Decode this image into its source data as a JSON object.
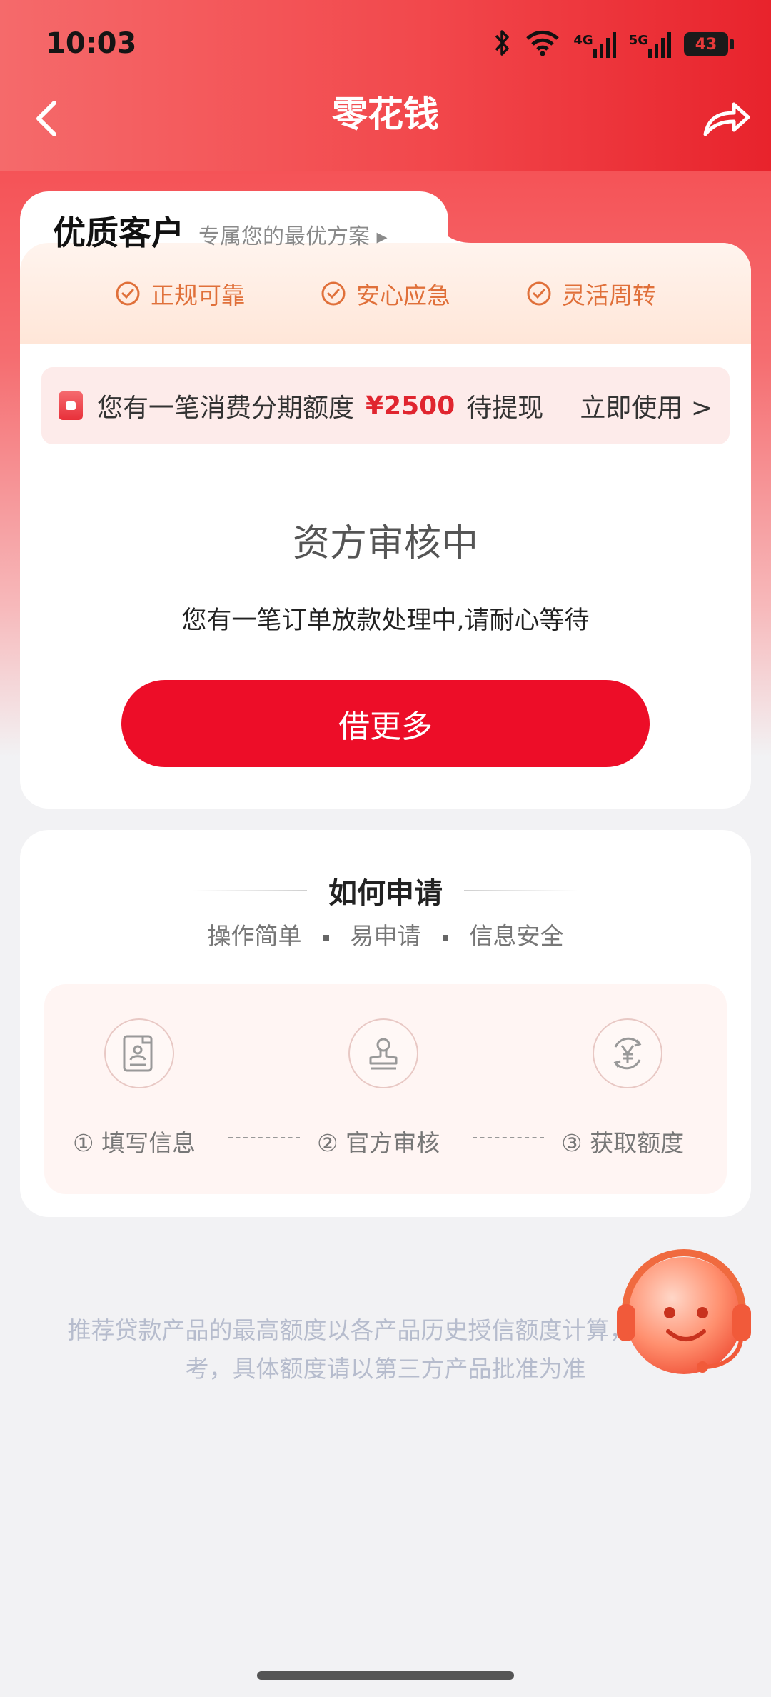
{
  "status_bar": {
    "time": "10:03",
    "battery": "43",
    "net1": "4G",
    "net2": "5G"
  },
  "header": {
    "title": "零花钱"
  },
  "tab": {
    "title": "优质客户",
    "subtitle": "专属您的最优方案 ▸"
  },
  "features": [
    {
      "label": "正规可靠"
    },
    {
      "label": "安心应急"
    },
    {
      "label": "灵活周转"
    }
  ],
  "banner": {
    "text_prefix": "您有一笔消费分期额度",
    "amount": "¥2500",
    "text_suffix": "待提现",
    "action": "立即使用 >"
  },
  "status": {
    "title": "资方审核中",
    "description": "您有一笔订单放款处理中,请耐心等待"
  },
  "borrow_button": "借更多",
  "how_to": {
    "title": "如何申请",
    "tags": [
      "操作简单",
      "易申请",
      "信息安全"
    ],
    "steps": [
      {
        "label": "① 填写信息",
        "icon": "form-icon"
      },
      {
        "label": "② 官方审核",
        "icon": "stamp-icon"
      },
      {
        "label": "③ 获取额度",
        "icon": "yuan-icon"
      }
    ],
    "dashes": [
      "----------",
      "----------"
    ]
  },
  "disclaimer": "推荐贷款产品的最高额度以各产品历史授信额度计算，仅供参考，具体额度请以第三方产品批准为准",
  "colors": {
    "brand_red": "#ed0d28",
    "accent_orange": "#e0703a"
  }
}
